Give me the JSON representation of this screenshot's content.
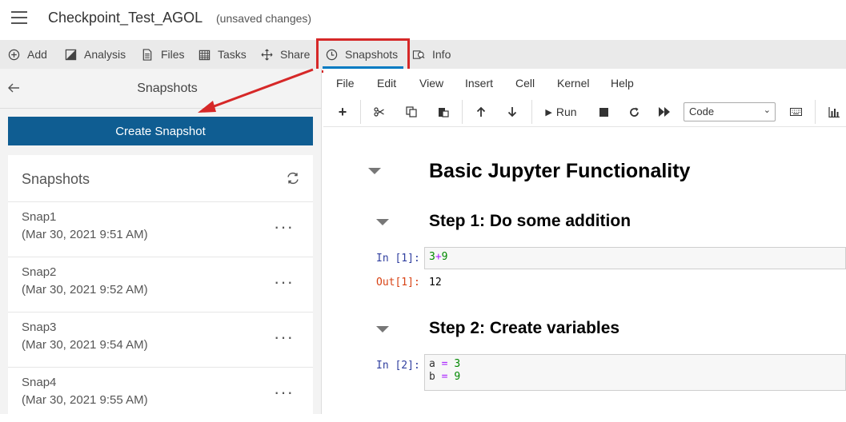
{
  "header": {
    "title": "Checkpoint_Test_AGOL",
    "status": "(unsaved changes)"
  },
  "toolbar": {
    "items": [
      {
        "label": "Add",
        "icon": "plus-circle-icon"
      },
      {
        "label": "Analysis",
        "icon": "analysis-icon"
      },
      {
        "label": "Files",
        "icon": "files-icon"
      },
      {
        "label": "Tasks",
        "icon": "tasks-icon"
      },
      {
        "label": "Share",
        "icon": "share-icon"
      },
      {
        "label": "Snapshots",
        "icon": "clock-icon"
      },
      {
        "label": "Info",
        "icon": "info-icon"
      }
    ],
    "active": "Snapshots"
  },
  "sidebar": {
    "title": "Snapshots",
    "create_button": "Create Snapshot",
    "card_title": "Snapshots",
    "snapshots": [
      {
        "name": "Snap1",
        "date": "(Mar 30, 2021 9:51 AM)"
      },
      {
        "name": "Snap2",
        "date": "(Mar 30, 2021 9:52 AM)"
      },
      {
        "name": "Snap3",
        "date": "(Mar 30, 2021 9:54 AM)"
      },
      {
        "name": "Snap4",
        "date": "(Mar 30, 2021 9:55 AM)"
      }
    ]
  },
  "notebook": {
    "menu": [
      "File",
      "Edit",
      "View",
      "Insert",
      "Cell",
      "Kernel",
      "Help"
    ],
    "run_label": "Run",
    "cell_type": "Code",
    "heading1": "Basic Jupyter Functionality",
    "heading2a": "Step 1: Do some addition",
    "heading2b": "Step 2: Create variables",
    "cell1": {
      "prompt_in": "In [1]:",
      "code_a": "3",
      "code_op": "+",
      "code_b": "9",
      "prompt_out": "Out[1]:",
      "output": "12"
    },
    "cell2": {
      "prompt_in": "In [2]:",
      "line1_var": "a",
      "line1_op": "=",
      "line1_val": "3",
      "line2_var": "b",
      "line2_op": "=",
      "line2_val": "9"
    }
  },
  "colors": {
    "accent": "#007ac2",
    "primary_button": "#0f5d92",
    "highlight": "#d62828"
  }
}
